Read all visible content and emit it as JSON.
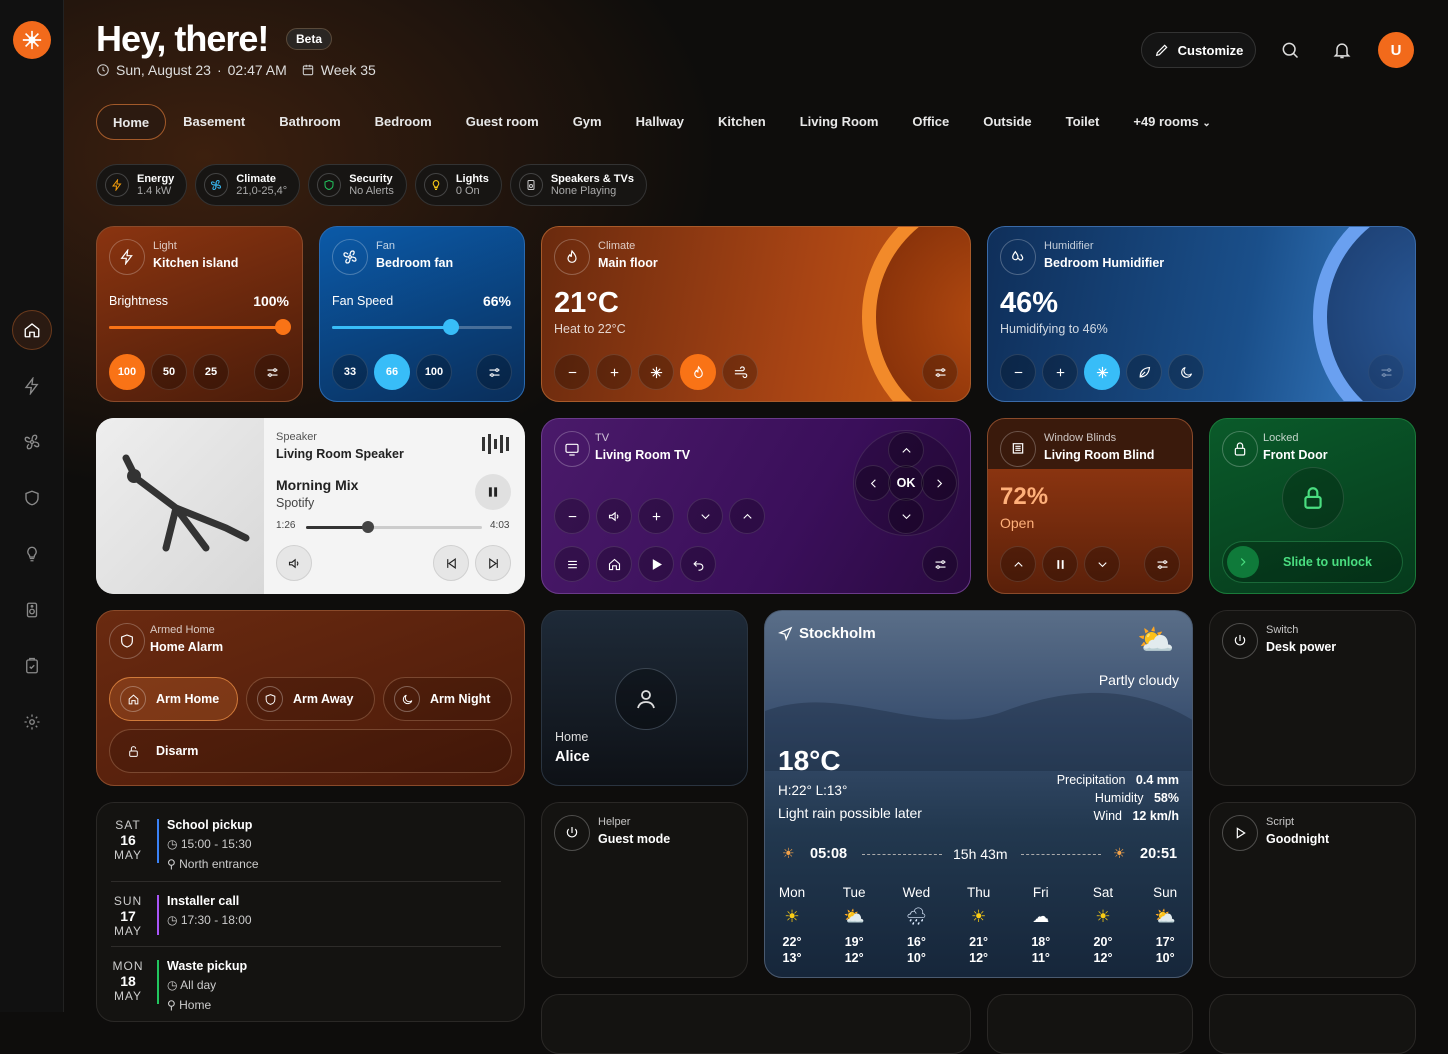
{
  "colors": {
    "accent": "#f26a1b",
    "background": "#0e0d0c"
  },
  "header": {
    "title": "Hey, there!",
    "badge": "Beta",
    "date": "Sun, August 23",
    "separator": "·",
    "time": "02:47 AM",
    "week": "Week 35",
    "customize": "Customize",
    "avatar_initial": "U"
  },
  "tabs": [
    "Home",
    "Basement",
    "Bathroom",
    "Bedroom",
    "Guest room",
    "Gym",
    "Hallway",
    "Kitchen",
    "Living Room",
    "Office",
    "Outside",
    "Toilet",
    "+49 rooms"
  ],
  "chips": [
    {
      "title": "Energy",
      "value": "1.4 kW",
      "icon": "lightning-icon"
    },
    {
      "title": "Climate",
      "value": "21,0-25,4°",
      "icon": "fan-icon"
    },
    {
      "title": "Security",
      "value": "No Alerts",
      "icon": "shield-icon"
    },
    {
      "title": "Lights",
      "value": "0 On",
      "icon": "bulb-icon"
    },
    {
      "title": "Speakers & TVs",
      "value": "None Playing",
      "icon": "speaker-icon"
    }
  ],
  "light": {
    "type": "Light",
    "name": "Kitchen island",
    "label": "Brightness",
    "value": "100%",
    "level": 100,
    "presets": [
      "100",
      "50",
      "25"
    ]
  },
  "fan": {
    "type": "Fan",
    "name": "Bedroom fan",
    "label": "Fan Speed",
    "value": "66%",
    "level": 66,
    "presets": [
      "33",
      "66",
      "100"
    ]
  },
  "climate": {
    "type": "Climate",
    "name": "Main floor",
    "temp": "21°C",
    "status": "Heat to 22°C"
  },
  "humidifier": {
    "type": "Humidifier",
    "name": "Bedroom Humidifier",
    "value": "46%",
    "status": "Humidifying to 46%"
  },
  "speaker": {
    "type": "Speaker",
    "name": "Living Room Speaker",
    "track": "Morning Mix",
    "source": "Spotify",
    "elapsed": "1:26",
    "duration": "4:03",
    "progress": 35
  },
  "tv": {
    "type": "TV",
    "name": "Living Room TV",
    "ok": "OK"
  },
  "blinds": {
    "type": "Window Blinds",
    "name": "Living Room Blind",
    "value": "72%",
    "status": "Open"
  },
  "lock": {
    "type": "Locked",
    "name": "Front Door",
    "slide": "Slide to unlock"
  },
  "alarm": {
    "type": "Armed Home",
    "name": "Home Alarm",
    "arm_home": "Arm Home",
    "arm_away": "Arm Away",
    "arm_night": "Arm Night",
    "disarm": "Disarm"
  },
  "person": {
    "location": "Home",
    "name": "Alice"
  },
  "weather": {
    "city": "Stockholm",
    "condition": "Partly cloudy",
    "temp": "18°C",
    "hilo": "H:22° L:13°",
    "forecast_text": "Light rain possible later",
    "precip_label": "Precipitation",
    "precip": "0.4 mm",
    "humidity_label": "Humidity",
    "humidity": "58%",
    "wind_label": "Wind",
    "wind": "12 km/h",
    "sunrise": "05:08",
    "daylight": "15h 43m",
    "sunset": "20:51",
    "days": [
      {
        "d": "Mon",
        "hi": "22°",
        "lo": "13°",
        "icon": "sun"
      },
      {
        "d": "Tue",
        "hi": "19°",
        "lo": "12°",
        "icon": "cloud-sun"
      },
      {
        "d": "Wed",
        "hi": "16°",
        "lo": "10°",
        "icon": "rain"
      },
      {
        "d": "Thu",
        "hi": "21°",
        "lo": "12°",
        "icon": "sun"
      },
      {
        "d": "Fri",
        "hi": "18°",
        "lo": "11°",
        "icon": "cloud"
      },
      {
        "d": "Sat",
        "hi": "20°",
        "lo": "12°",
        "icon": "sun"
      },
      {
        "d": "Sun",
        "hi": "17°",
        "lo": "10°",
        "icon": "cloud-sun"
      }
    ]
  },
  "switch": {
    "type": "Switch",
    "name": "Desk power"
  },
  "helper": {
    "type": "Helper",
    "name": "Guest mode"
  },
  "script": {
    "type": "Script",
    "name": "Goodnight"
  },
  "events": [
    {
      "dow": "SAT",
      "day": "16",
      "mon": "MAY",
      "title": "School pickup",
      "time": "15:00 - 15:30",
      "place": "North entrance",
      "color": "#3b82f6"
    },
    {
      "dow": "SUN",
      "day": "17",
      "mon": "MAY",
      "title": "Installer call",
      "time": "17:30 - 18:00",
      "color": "#a855f7"
    },
    {
      "dow": "MON",
      "day": "18",
      "mon": "MAY",
      "title": "Waste pickup",
      "time": "All day",
      "place": "Home",
      "color": "#22c55e"
    }
  ]
}
